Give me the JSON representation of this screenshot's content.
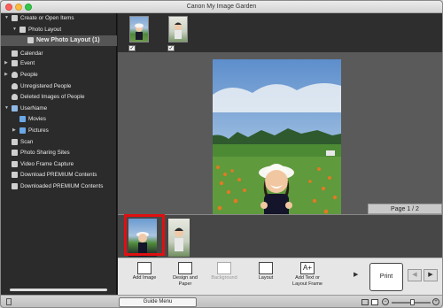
{
  "window": {
    "title": "Canon My Image Garden"
  },
  "sidebar": {
    "items": [
      {
        "label": "Create or Open Items",
        "tri": "▼",
        "icon": "create-items-icon",
        "indent": 0
      },
      {
        "label": "Photo Layout",
        "tri": "▼",
        "icon": "photo-layout-icon",
        "indent": 1
      },
      {
        "label": "New Photo Layout (1)",
        "tri": "",
        "icon": "layout-item-icon",
        "indent": 2,
        "selected": true
      },
      {
        "label": "Calendar",
        "tri": "",
        "icon": "calendar-icon",
        "indent": 0
      },
      {
        "label": "Event",
        "tri": "▶",
        "icon": "event-icon",
        "indent": 0
      },
      {
        "label": "People",
        "tri": "▶",
        "icon": "people-icon",
        "indent": 0
      },
      {
        "label": "Unregistered People",
        "tri": "",
        "icon": "unregistered-people-icon",
        "indent": 0
      },
      {
        "label": "Deleted Images of People",
        "tri": "",
        "icon": "deleted-people-icon",
        "indent": 0
      },
      {
        "label": "UserName",
        "tri": "▼",
        "icon": "computer-icon",
        "indent": 0
      },
      {
        "label": "Movies",
        "tri": "",
        "icon": "folder-icon",
        "indent": 1
      },
      {
        "label": "Pictures",
        "tri": "▶",
        "icon": "folder-icon",
        "indent": 1
      },
      {
        "label": "Scan",
        "tri": "",
        "icon": "scan-icon",
        "indent": 0
      },
      {
        "label": "Photo Sharing Sites",
        "tri": "",
        "icon": "photo-sharing-icon",
        "indent": 0
      },
      {
        "label": "Video Frame Capture",
        "tri": "",
        "icon": "video-capture-icon",
        "indent": 0
      },
      {
        "label": "Download PREMIUM Contents",
        "tri": "",
        "icon": "download-icon",
        "indent": 0
      },
      {
        "label": "Downloaded PREMIUM Contents",
        "tri": "",
        "icon": "downloaded-icon",
        "indent": 0
      }
    ]
  },
  "editor": {
    "page_label": "Page 1 / 2"
  },
  "toolbar": {
    "add_image": "Add Image",
    "design_paper": [
      "Design and",
      "Paper"
    ],
    "background": "Background",
    "layout": "Layout",
    "add_text": [
      "Add Text or",
      "Layout Frame"
    ],
    "print": "Print"
  },
  "status": {
    "guide_menu": "Guide Menu"
  },
  "colors": {
    "selection_border": "#e01010",
    "sidebar_selected": "#555555"
  }
}
